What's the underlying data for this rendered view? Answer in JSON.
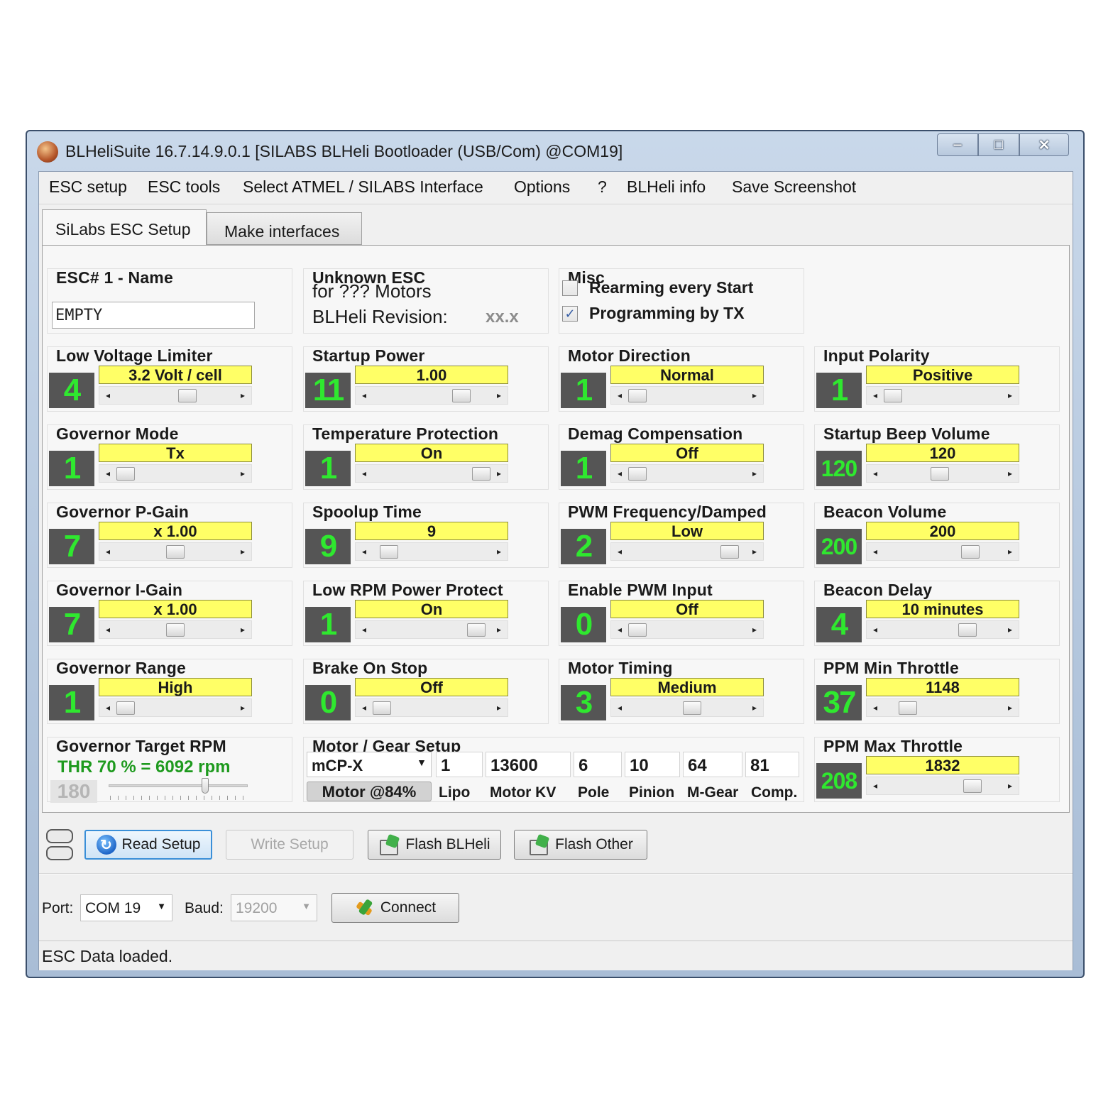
{
  "window": {
    "title": "BLHeliSuite 16.7.14.9.0.1  [SILABS BLHeli Bootloader (USB/Com) @COM19]",
    "controls": {
      "minimize": "‒",
      "maximize": "□",
      "close": "✕"
    }
  },
  "menu": [
    "ESC setup",
    "ESC tools",
    "Select ATMEL / SILABS Interface",
    "Options",
    "?",
    "BLHeli info",
    "Save Screenshot"
  ],
  "tabs": [
    "SiLabs ESC Setup",
    "Make interfaces"
  ],
  "esc_name": {
    "title": "ESC# 1 - Name",
    "value": "EMPTY"
  },
  "esc_info": {
    "title": "Unknown ESC",
    "line1": "for  ???  Motors",
    "revision_label": "BLHeli Revision:",
    "revision_value": "xx.x"
  },
  "misc": {
    "title": "Misc",
    "options": [
      {
        "label": "Rearming every Start",
        "checked": false
      },
      {
        "label": "Programming by TX",
        "checked": true
      }
    ]
  },
  "settings": [
    {
      "title": "Low Voltage Limiter",
      "num": "4",
      "value": "3.2 Volt / cell",
      "slider_pos": 0.62
    },
    {
      "title": "Startup Power",
      "num": "11",
      "value": "1.00",
      "slider_pos": 0.8
    },
    {
      "title": "Motor Direction",
      "num": "1",
      "value": "Normal",
      "slider_pos": 0.0
    },
    {
      "title": "Input Polarity",
      "num": "1",
      "value": "Positive",
      "slider_pos": 0.0
    },
    {
      "title": "Governor Mode",
      "num": "1",
      "value": "Tx",
      "slider_pos": 0.0
    },
    {
      "title": "Temperature Protection",
      "num": "1",
      "value": "On",
      "slider_pos": 1.0
    },
    {
      "title": "Demag Compensation",
      "num": "1",
      "value": "Off",
      "slider_pos": 0.0
    },
    {
      "title": "Startup Beep Volume",
      "num": "120",
      "value": "120",
      "slider_pos": 0.47
    },
    {
      "title": "Governor P-Gain",
      "num": "7",
      "value": "x 1.00",
      "slider_pos": 0.5
    },
    {
      "title": "Spoolup Time",
      "num": "9",
      "value": "9",
      "slider_pos": 0.07
    },
    {
      "title": "PWM Frequency/Damped",
      "num": "2",
      "value": "Low",
      "slider_pos": 0.93
    },
    {
      "title": "Beacon Volume",
      "num": "200",
      "value": "200",
      "slider_pos": 0.78
    },
    {
      "title": "Governor I-Gain",
      "num": "7",
      "value": "x 1.00",
      "slider_pos": 0.5
    },
    {
      "title": "Low RPM Power Protect",
      "num": "1",
      "value": "On",
      "slider_pos": 0.95
    },
    {
      "title": "Enable PWM Input",
      "num": "0",
      "value": "Off",
      "slider_pos": 0.0
    },
    {
      "title": "Beacon Delay",
      "num": "4",
      "value": "10 minutes",
      "slider_pos": 0.75
    },
    {
      "title": "Governor Range",
      "num": "1",
      "value": "High",
      "slider_pos": 0.0
    },
    {
      "title": "Brake On Stop",
      "num": "0",
      "value": "Off",
      "slider_pos": 0.0
    },
    {
      "title": "Motor Timing",
      "num": "3",
      "value": "Medium",
      "slider_pos": 0.55
    },
    {
      "title": "PPM Min Throttle",
      "num": "37",
      "value": "1148",
      "slider_pos": 0.15
    },
    {
      "title": "PPM Max Throttle",
      "num": "208",
      "value": "1832",
      "slider_pos": 0.8
    }
  ],
  "governor_target": {
    "title": "Governor Target RPM",
    "text": "THR 70 % = 6092 rpm",
    "num": "180",
    "slider_pos": 0.7
  },
  "motor_gear": {
    "title": "Motor / Gear Setup",
    "model": "mCP-X",
    "lipo": "1",
    "kv": "13600",
    "pole": "6",
    "pinion": "10",
    "mgear": "64",
    "comp": "81",
    "labels": {
      "lipo": "Lipo",
      "kv": "Motor KV",
      "pole": "Pole",
      "pinion": "Pinion",
      "mgear": "M-Gear",
      "comp": "Comp."
    },
    "motor_badge": "Motor @84%"
  },
  "actions": {
    "read": "Read Setup",
    "write": "Write Setup",
    "flash_blheli": "Flash BLHeli",
    "flash_other": "Flash Other"
  },
  "connection": {
    "port_label": "Port:",
    "port_value": "COM 19",
    "baud_label": "Baud:",
    "baud_value": "19200",
    "connect": "Connect"
  },
  "status": "ESC Data loaded.",
  "colors": {
    "value_bg": "#ffff66",
    "digit": "#2fe82f",
    "digit_bg": "#555555",
    "rpm_text": "#1e9a1e"
  }
}
